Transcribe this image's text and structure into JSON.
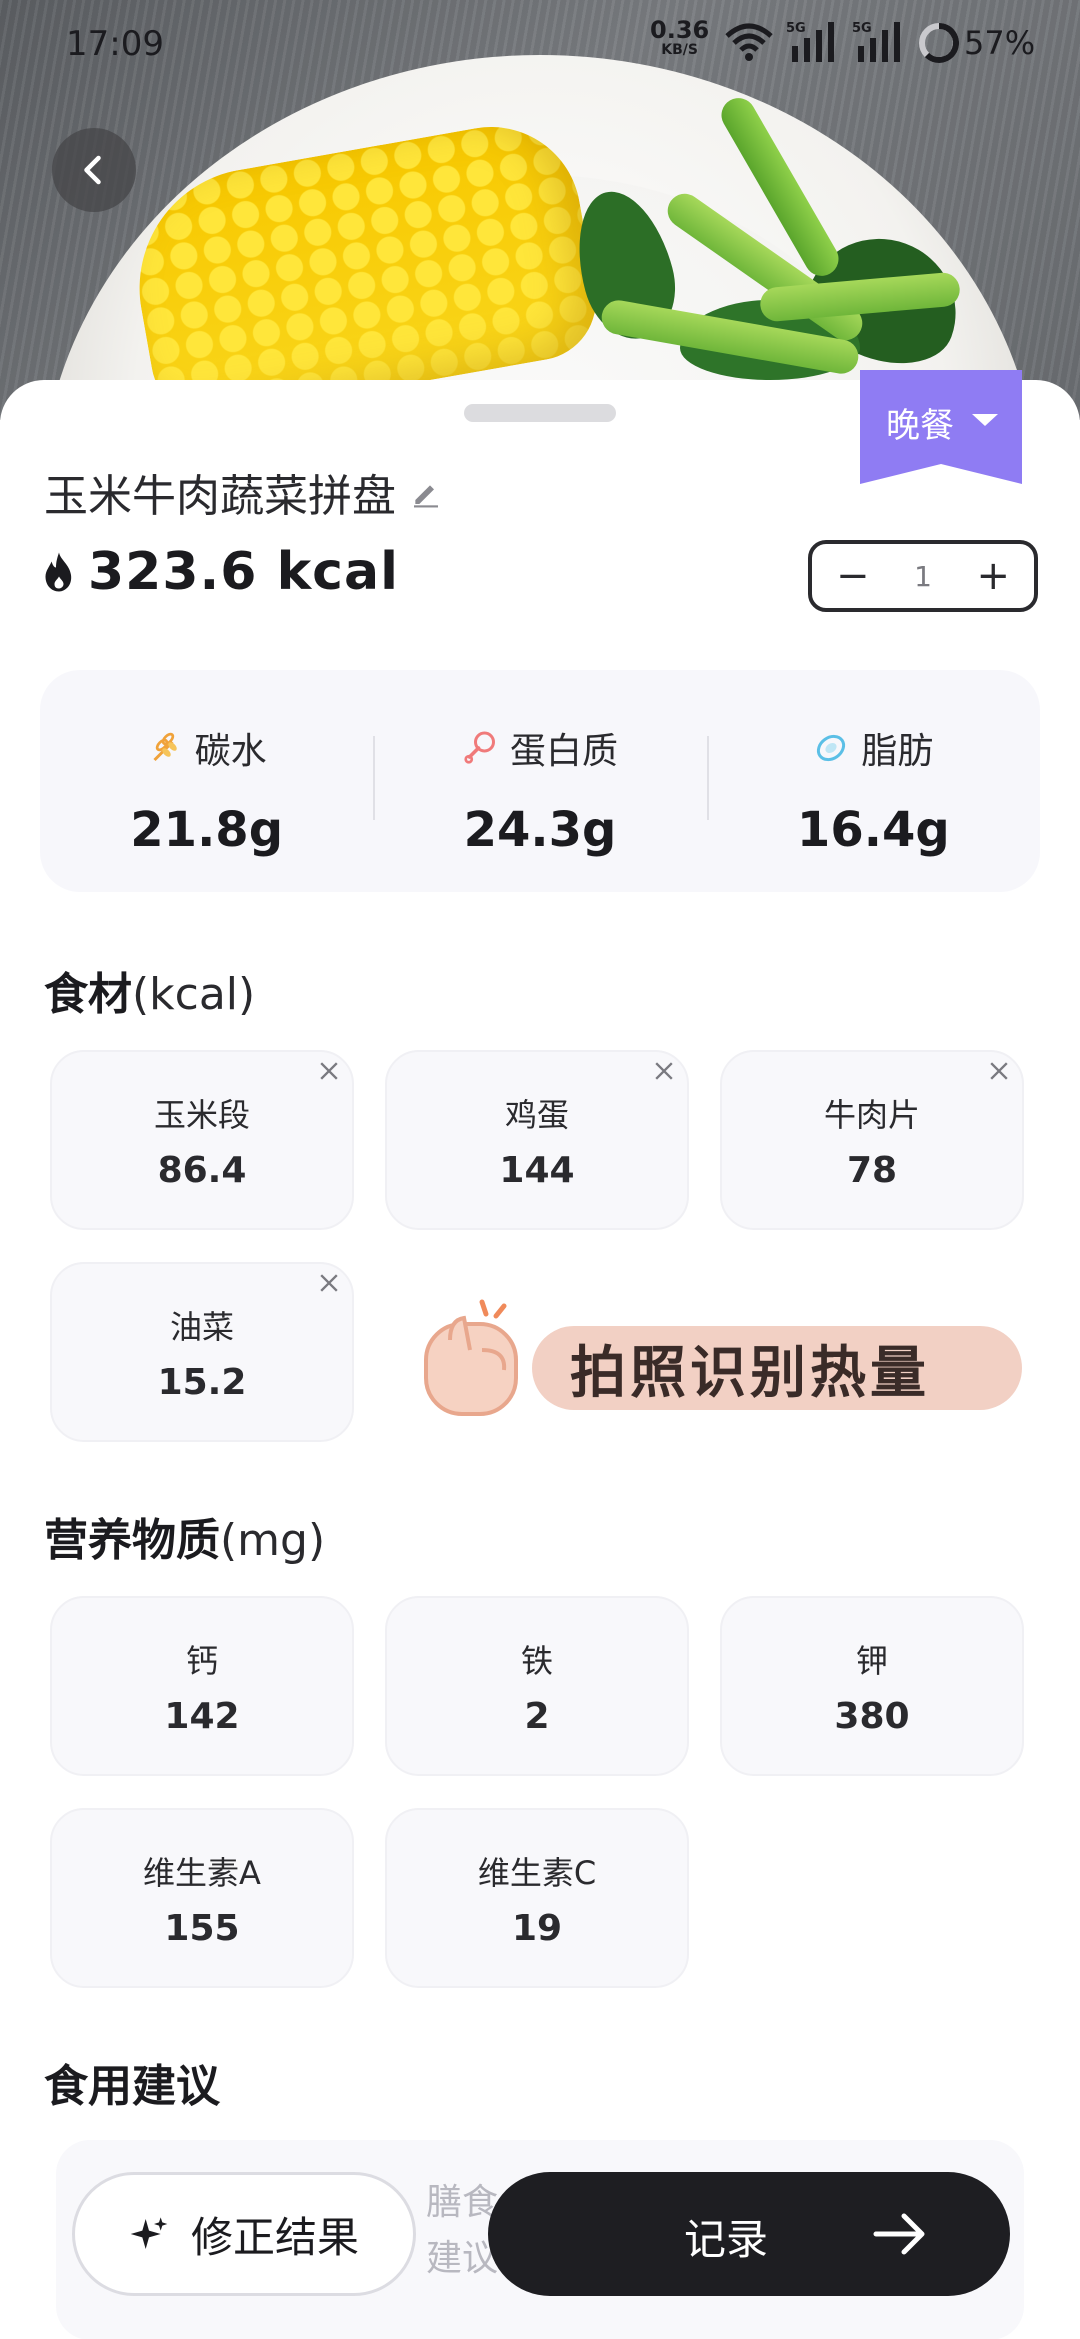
{
  "status_bar": {
    "time": "17:09",
    "net_speed": "0.36",
    "net_unit": "KB/S",
    "sim1": "5G",
    "sim2": "5G",
    "battery": "57%"
  },
  "meal_tag": {
    "label": "晚餐",
    "color": "#8f7cf3"
  },
  "dish": {
    "name": "玉米牛肉蔬菜拼盘",
    "calories": "323.6 kcal",
    "quantity": "1"
  },
  "macros": [
    {
      "label": "碳水",
      "amount": "21.8g",
      "icon": "wheat-icon",
      "color": "#f0a23a"
    },
    {
      "label": "蛋白质",
      "amount": "24.3g",
      "icon": "drumstick-icon",
      "color": "#f07a7a"
    },
    {
      "label": "脂肪",
      "amount": "16.4g",
      "icon": "oil-drop-icon",
      "color": "#5bbfe6"
    }
  ],
  "ingredients": {
    "title": "食材",
    "unit": "(kcal)",
    "items": [
      {
        "name": "玉米段",
        "value": "86.4"
      },
      {
        "name": "鸡蛋",
        "value": "144"
      },
      {
        "name": "牛肉片",
        "value": "78"
      },
      {
        "name": "油菜",
        "value": "15.2"
      }
    ]
  },
  "promo": {
    "text": "拍照识别热量"
  },
  "nutrients": {
    "title": "营养物质",
    "unit": "(mg)",
    "items": [
      {
        "name": "钙",
        "value": "142"
      },
      {
        "name": "铁",
        "value": "2"
      },
      {
        "name": "钾",
        "value": "380"
      },
      {
        "name": "维生素A",
        "value": "155"
      },
      {
        "name": "维生素C",
        "value": "19"
      }
    ]
  },
  "advice": {
    "title": "食用建议",
    "partial_text_line1": "膳食",
    "partial_text_line2": "建议"
  },
  "actions": {
    "fix_label": "修正结果",
    "record_label": "记录"
  }
}
